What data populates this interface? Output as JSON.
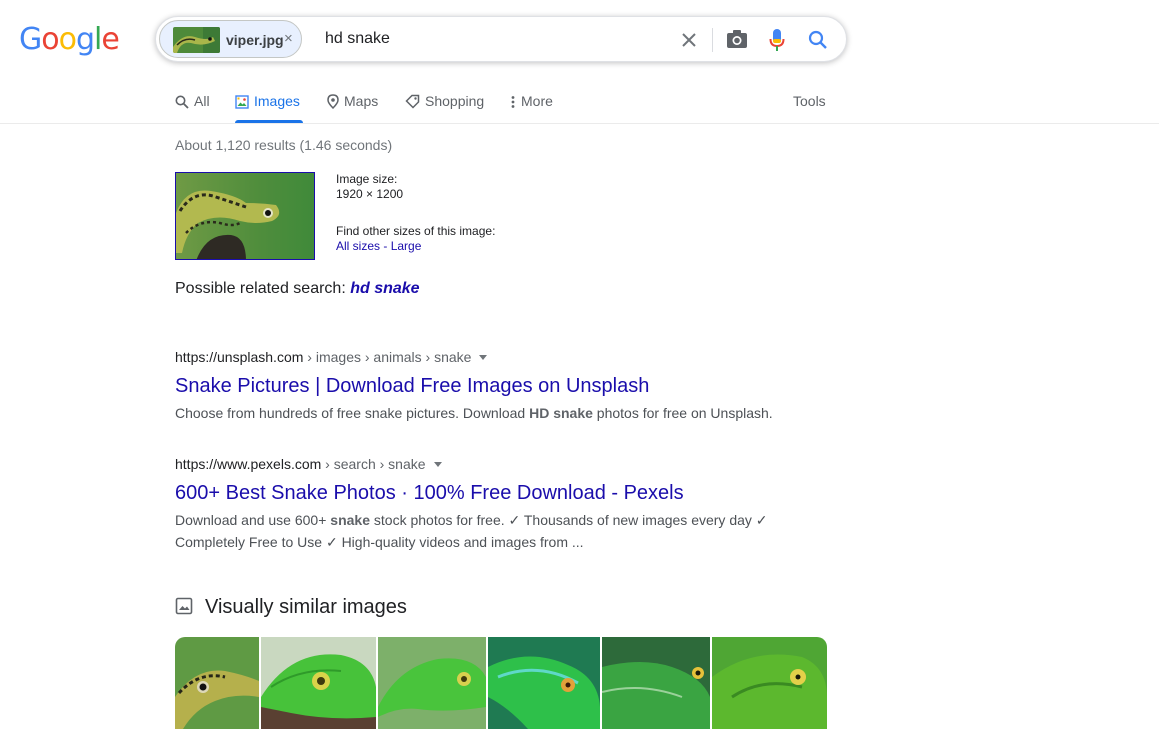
{
  "logo": {
    "letters": [
      "G",
      "o",
      "o",
      "g",
      "l",
      "e"
    ],
    "colors": [
      "#4285f4",
      "#ea4335",
      "#fbbc05",
      "#4285f4",
      "#34a853",
      "#ea4335"
    ]
  },
  "search": {
    "chip_label": "viper.jpg",
    "chip_remove": "×",
    "query": "hd snake"
  },
  "tabs": [
    {
      "label": "All",
      "icon": "search-icon"
    },
    {
      "label": "Images",
      "icon": "image-icon",
      "active": true
    },
    {
      "label": "Maps",
      "icon": "map-pin-icon"
    },
    {
      "label": "Shopping",
      "icon": "tag-icon"
    },
    {
      "label": "More",
      "icon": "more-vert-icon"
    }
  ],
  "tools_label": "Tools",
  "stats": "About 1,120 results (1.46 seconds)",
  "query_image": {
    "size_label": "Image size:",
    "size_value": "1920 × 1200",
    "other_sizes_label": "Find other sizes of this image:",
    "all_sizes": "All sizes",
    "separator": " - ",
    "large": "Large"
  },
  "related": {
    "prefix": "Possible related search: ",
    "term": "hd snake"
  },
  "results": [
    {
      "site": "https://unsplash.com",
      "path": " › images › animals › snake",
      "title": "Snake Pictures | Download Free Images on Unsplash",
      "snippet_parts": [
        {
          "t": "Choose from hundreds of free snake pictures. Download "
        },
        {
          "t": "HD snake",
          "b": true
        },
        {
          "t": " photos for free on Unsplash."
        }
      ]
    },
    {
      "site": "https://www.pexels.com",
      "path": " › search › snake",
      "title": "600+ Best Snake Photos · 100% Free Download - Pexels",
      "snippet_line1_parts": [
        {
          "t": "Download and use 600+ "
        },
        {
          "t": "snake",
          "b": true
        },
        {
          "t": " stock photos for free. ✓ Thousands of new images every day ✓"
        }
      ],
      "snippet_line2": "Completely Free to Use ✓ High-quality videos and images from ..."
    }
  ],
  "similar": {
    "heading": "Visually similar images",
    "count": 6
  },
  "colors": {
    "link": "#1a0dab",
    "accent": "#1a73e8",
    "snake_green": "#5cb82e"
  }
}
